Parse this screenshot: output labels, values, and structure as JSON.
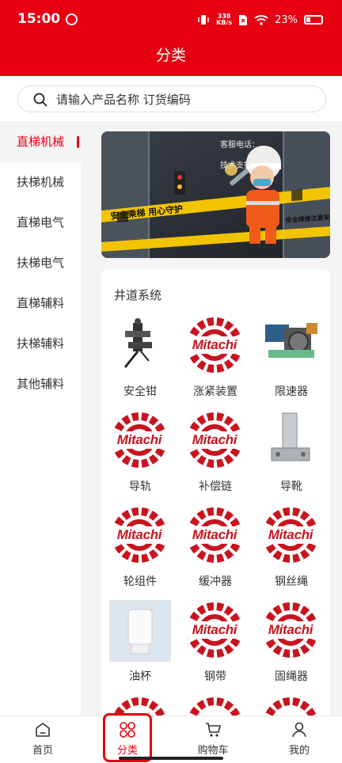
{
  "status": {
    "time": "15:00",
    "net_value": "338",
    "net_unit": "KB/s",
    "battery": "23%"
  },
  "header": {
    "title": "分类"
  },
  "search": {
    "placeholder": "请输入产品名称 订货编码"
  },
  "sidebar": {
    "items": [
      {
        "label": "直梯机械",
        "active": true
      },
      {
        "label": "扶梯机械"
      },
      {
        "label": "直梯电气"
      },
      {
        "label": "扶梯电气"
      },
      {
        "label": "直梯辅料"
      },
      {
        "label": "扶梯辅料"
      },
      {
        "label": "其他辅料"
      }
    ]
  },
  "banner": {
    "tape_text": "安全乘梯 用心守护",
    "tape_text_2": "安全维修注意安全",
    "phone_line_1": "客服电话：",
    "phone_line_2": "技术支持："
  },
  "section": {
    "title": "井道系统",
    "items": [
      {
        "label": "安全钳",
        "image": "safety-gear-photo"
      },
      {
        "label": "涨紧装置",
        "image": "mitachi-logo"
      },
      {
        "label": "限速器",
        "image": "speed-governor-photo"
      },
      {
        "label": "导轨",
        "image": "mitachi-logo"
      },
      {
        "label": "补偿链",
        "image": "mitachi-logo"
      },
      {
        "label": "导靴",
        "image": "guide-shoe-photo"
      },
      {
        "label": "轮组件",
        "image": "mitachi-logo"
      },
      {
        "label": "缓冲器",
        "image": "mitachi-logo"
      },
      {
        "label": "钢丝绳",
        "image": "mitachi-logo"
      },
      {
        "label": "油杯",
        "image": "oil-cup-photo"
      },
      {
        "label": "钢带",
        "image": "mitachi-logo"
      },
      {
        "label": "固绳器",
        "image": "mitachi-logo"
      }
    ],
    "logo_text": "Mitachi"
  },
  "tabs": [
    {
      "label": "首页",
      "icon": "home-icon"
    },
    {
      "label": "分类",
      "icon": "category-icon",
      "active": true
    },
    {
      "label": "购物车",
      "icon": "cart-icon"
    },
    {
      "label": "我的",
      "icon": "user-icon"
    }
  ],
  "colors": {
    "brand": "#e60012",
    "logo_red": "#c8141e"
  }
}
